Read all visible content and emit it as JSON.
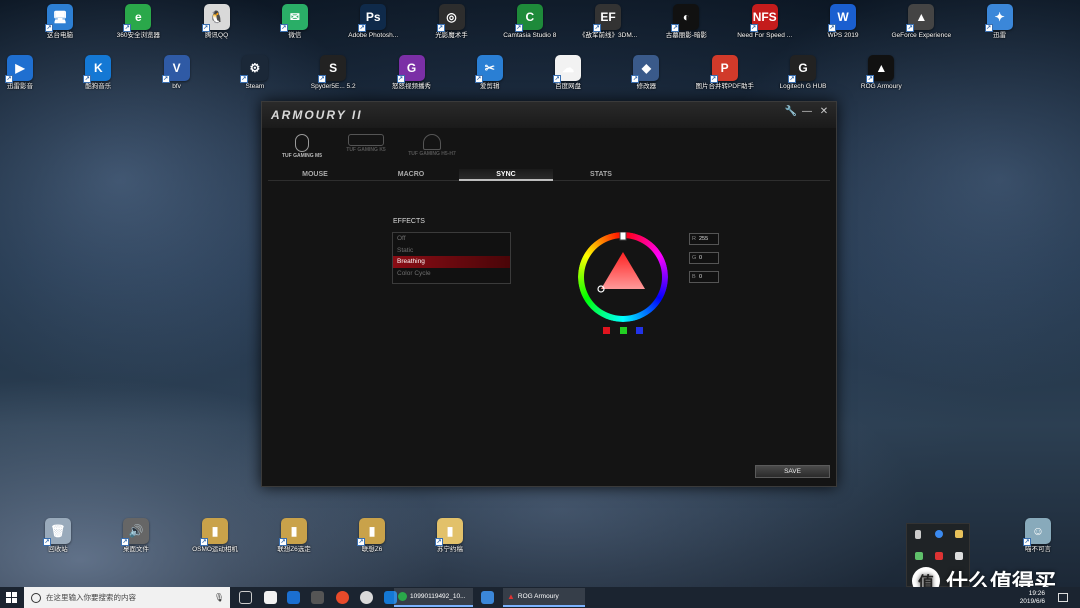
{
  "desktop": {
    "row1": [
      {
        "label": "这台电脑",
        "color": "#2d7fd3",
        "glyph": "🖥"
      },
      {
        "label": "360安全浏览器",
        "color": "#2aa84a",
        "glyph": "e"
      },
      {
        "label": "腾讯QQ",
        "color": "#d9d9d9",
        "glyph": "🐧"
      },
      {
        "label": "微信",
        "color": "#2aae67",
        "glyph": "✉"
      },
      {
        "label": "Adobe Photosh...",
        "color": "#0f2a4a",
        "glyph": "Ps"
      },
      {
        "label": "光影魔术手",
        "color": "#2d2d2d",
        "glyph": "◎"
      },
      {
        "label": "Camtasia Studio 8",
        "color": "#1e8a3a",
        "glyph": "C"
      },
      {
        "label": "《敌军前线》3DM...",
        "color": "#333",
        "glyph": "EF"
      },
      {
        "label": "古墓丽影-暗影",
        "color": "#111",
        "glyph": "◐"
      },
      {
        "label": "Need For Speed ...",
        "color": "#c41c1c",
        "glyph": "NFS"
      },
      {
        "label": "WPS 2019",
        "color": "#1a5fd0",
        "glyph": "W"
      },
      {
        "label": "GeForce Experience",
        "color": "#444",
        "glyph": "▲"
      },
      {
        "label": "迅雷",
        "color": "#3b87d9",
        "glyph": "✦"
      }
    ],
    "row2": [
      {
        "label": "迅雷影音",
        "color": "#1f6fd0",
        "glyph": "▶"
      },
      {
        "label": "酷狗音乐",
        "color": "#1478d4",
        "glyph": "K"
      },
      {
        "label": "bfv",
        "color": "#2f5aa5",
        "glyph": "V"
      },
      {
        "label": "Steam",
        "color": "#1b2838",
        "glyph": "⚙"
      },
      {
        "label": "Spyder5E... 5.2",
        "color": "#222",
        "glyph": "S"
      },
      {
        "label": "怒怒视频播秀",
        "color": "#7b2fa6",
        "glyph": "G"
      },
      {
        "label": "爱剪辑",
        "color": "#2a7fd4",
        "glyph": "✂"
      },
      {
        "label": "百度网盘",
        "color": "#f2f2f2",
        "glyph": "☁"
      },
      {
        "label": "修改器",
        "color": "#3a5a8a",
        "glyph": "◆"
      },
      {
        "label": "图片合并转PDF助手",
        "color": "#d13a2a",
        "glyph": "P"
      },
      {
        "label": "Logitech G HUB",
        "color": "#222",
        "glyph": "G"
      },
      {
        "label": "ROG Armoury",
        "color": "#111",
        "glyph": "▲"
      }
    ],
    "bottom": [
      {
        "label": "回收站",
        "color": "#9ab",
        "glyph": "🗑"
      },
      {
        "label": "桌面文件",
        "color": "#666",
        "glyph": "🔊"
      },
      {
        "label": "OSMO运动相机",
        "color": "#c9a24a",
        "glyph": "▮"
      },
      {
        "label": "联想Z6选定",
        "color": "#c9a24a",
        "glyph": "▮"
      },
      {
        "label": "联想Z6",
        "color": "#c9a24a",
        "glyph": "▮"
      },
      {
        "label": "苏宁约稿",
        "color": "#e2c16a",
        "glyph": "▮"
      },
      {
        "label": "喵不可言",
        "color": "#8ab",
        "glyph": "☺"
      }
    ]
  },
  "app": {
    "logo": "ARMOURY II",
    "window_buttons": {
      "settings": "🔧",
      "minimize": "—",
      "close": "✕"
    },
    "devices": [
      {
        "label": "TUF GAMING M5"
      },
      {
        "label": "TUF GAMING K5"
      },
      {
        "label": "TUF GAMING H5-H7"
      }
    ],
    "tabs": [
      "MOUSE",
      "MACRO",
      "SYNC",
      "STATS"
    ],
    "active_tab": "SYNC",
    "effects_title": "EFFECTS",
    "effects": [
      "Off",
      "Static",
      "Breathing",
      "Color Cycle"
    ],
    "selected_effect": "Breathing",
    "rgb": {
      "r_key": "R",
      "r": "255",
      "g_key": "G",
      "g": "0",
      "b_key": "B",
      "b": "0"
    },
    "swatch_colors": [
      "#e0141e",
      "#22d022",
      "#2233e8"
    ],
    "save": "SAVE"
  },
  "taskbar": {
    "search_placeholder": "在这里输入你要搜索的内容",
    "apps": [
      {
        "label": "10990119492_10..."
      },
      {
        "label": "ROG Armoury"
      }
    ],
    "clock_time": "19:26",
    "clock_date": "2019/6/6"
  },
  "watermark": {
    "glyph": "值",
    "text": "什么值得买"
  }
}
